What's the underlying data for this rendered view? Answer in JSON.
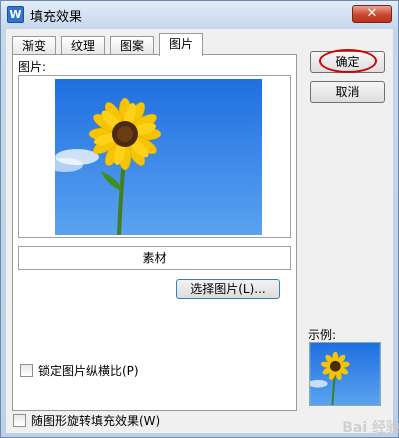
{
  "window": {
    "title": "填充效果",
    "app_icon_letter": "W",
    "close_symbol": "✕"
  },
  "tabs": [
    {
      "label": "渐变",
      "active": false
    },
    {
      "label": "纹理",
      "active": false
    },
    {
      "label": "图案",
      "active": false
    },
    {
      "label": "图片",
      "active": true
    }
  ],
  "panel": {
    "picture_label": "图片:",
    "material_name": "素材",
    "choose_button": "选择图片(L)...",
    "lock_aspect_label": "锁定图片纵横比(P)",
    "lock_aspect_checked": false
  },
  "rotate_with_shape_label": "随图形旋转填充效果(W)",
  "rotate_with_shape_checked": false,
  "buttons": {
    "ok": "确定",
    "cancel": "取消"
  },
  "sample_label": "示例:",
  "watermark": "Bai 经验",
  "colors": {
    "sky_top": "#1f6fe0",
    "sky_bottom": "#5aa3f0",
    "petal": "#f6c400",
    "flower_center": "#4a2a10",
    "highlight_ring": "#d40000"
  }
}
